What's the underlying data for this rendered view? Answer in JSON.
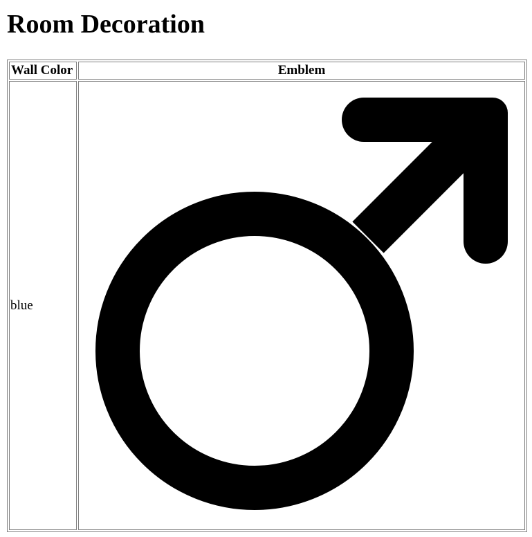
{
  "page": {
    "title": "Room Decoration"
  },
  "table": {
    "headers": [
      "Wall Color",
      "Emblem"
    ],
    "rows": [
      {
        "wall_color": "blue",
        "emblem": "male-symbol-icon"
      }
    ]
  }
}
